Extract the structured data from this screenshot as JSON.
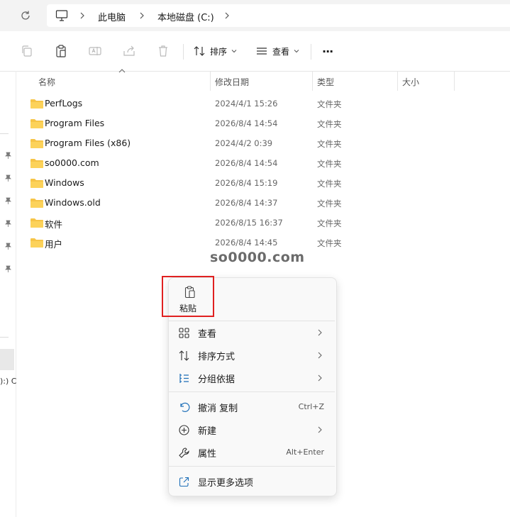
{
  "address_bar": {
    "crumbs": [
      "此电脑",
      "本地磁盘 (C:)"
    ]
  },
  "toolbar": {
    "sort_label": "排序",
    "view_label": "查看",
    "more_label": "···"
  },
  "columns": {
    "name": "名称",
    "modified": "修改日期",
    "type": "类型",
    "size": "大小"
  },
  "files": [
    {
      "name": "PerfLogs",
      "modified": "2024/4/1 15:26",
      "type": "文件夹"
    },
    {
      "name": "Program Files",
      "modified": "2026/8/4 14:54",
      "type": "文件夹"
    },
    {
      "name": "Program Files (x86)",
      "modified": "2024/4/2 0:39",
      "type": "文件夹"
    },
    {
      "name": "so0000.com",
      "modified": "2026/8/4 14:54",
      "type": "文件夹"
    },
    {
      "name": "Windows",
      "modified": "2026/8/4 15:19",
      "type": "文件夹"
    },
    {
      "name": "Windows.old",
      "modified": "2026/8/4 14:37",
      "type": "文件夹"
    },
    {
      "name": "软件",
      "modified": "2026/8/15 16:37",
      "type": "文件夹"
    },
    {
      "name": "用户",
      "modified": "2026/8/4 14:45",
      "type": "文件夹"
    }
  ],
  "watermark": "so0000.com",
  "left_pane": {
    "partial_text": "):) C"
  },
  "context_menu": {
    "paste_label": "粘贴",
    "items": [
      {
        "label": "查看",
        "shortcut": "",
        "submenu": true,
        "icon": "grid-icon"
      },
      {
        "label": "排序方式",
        "shortcut": "",
        "submenu": true,
        "icon": "sort-icon"
      },
      {
        "label": "分组依据",
        "shortcut": "",
        "submenu": true,
        "icon": "group-icon"
      },
      {
        "label": "撤消 复制",
        "shortcut": "Ctrl+Z",
        "submenu": false,
        "icon": "undo-icon"
      },
      {
        "label": "新建",
        "shortcut": "",
        "submenu": true,
        "icon": "new-icon"
      },
      {
        "label": "属性",
        "shortcut": "Alt+Enter",
        "submenu": false,
        "icon": "wrench-icon"
      },
      {
        "label": "显示更多选项",
        "shortcut": "",
        "submenu": false,
        "icon": "share-icon"
      }
    ]
  },
  "colors": {
    "folder": "#f6c447",
    "highlight_box": "#e02020",
    "accent": "#0067c0"
  }
}
